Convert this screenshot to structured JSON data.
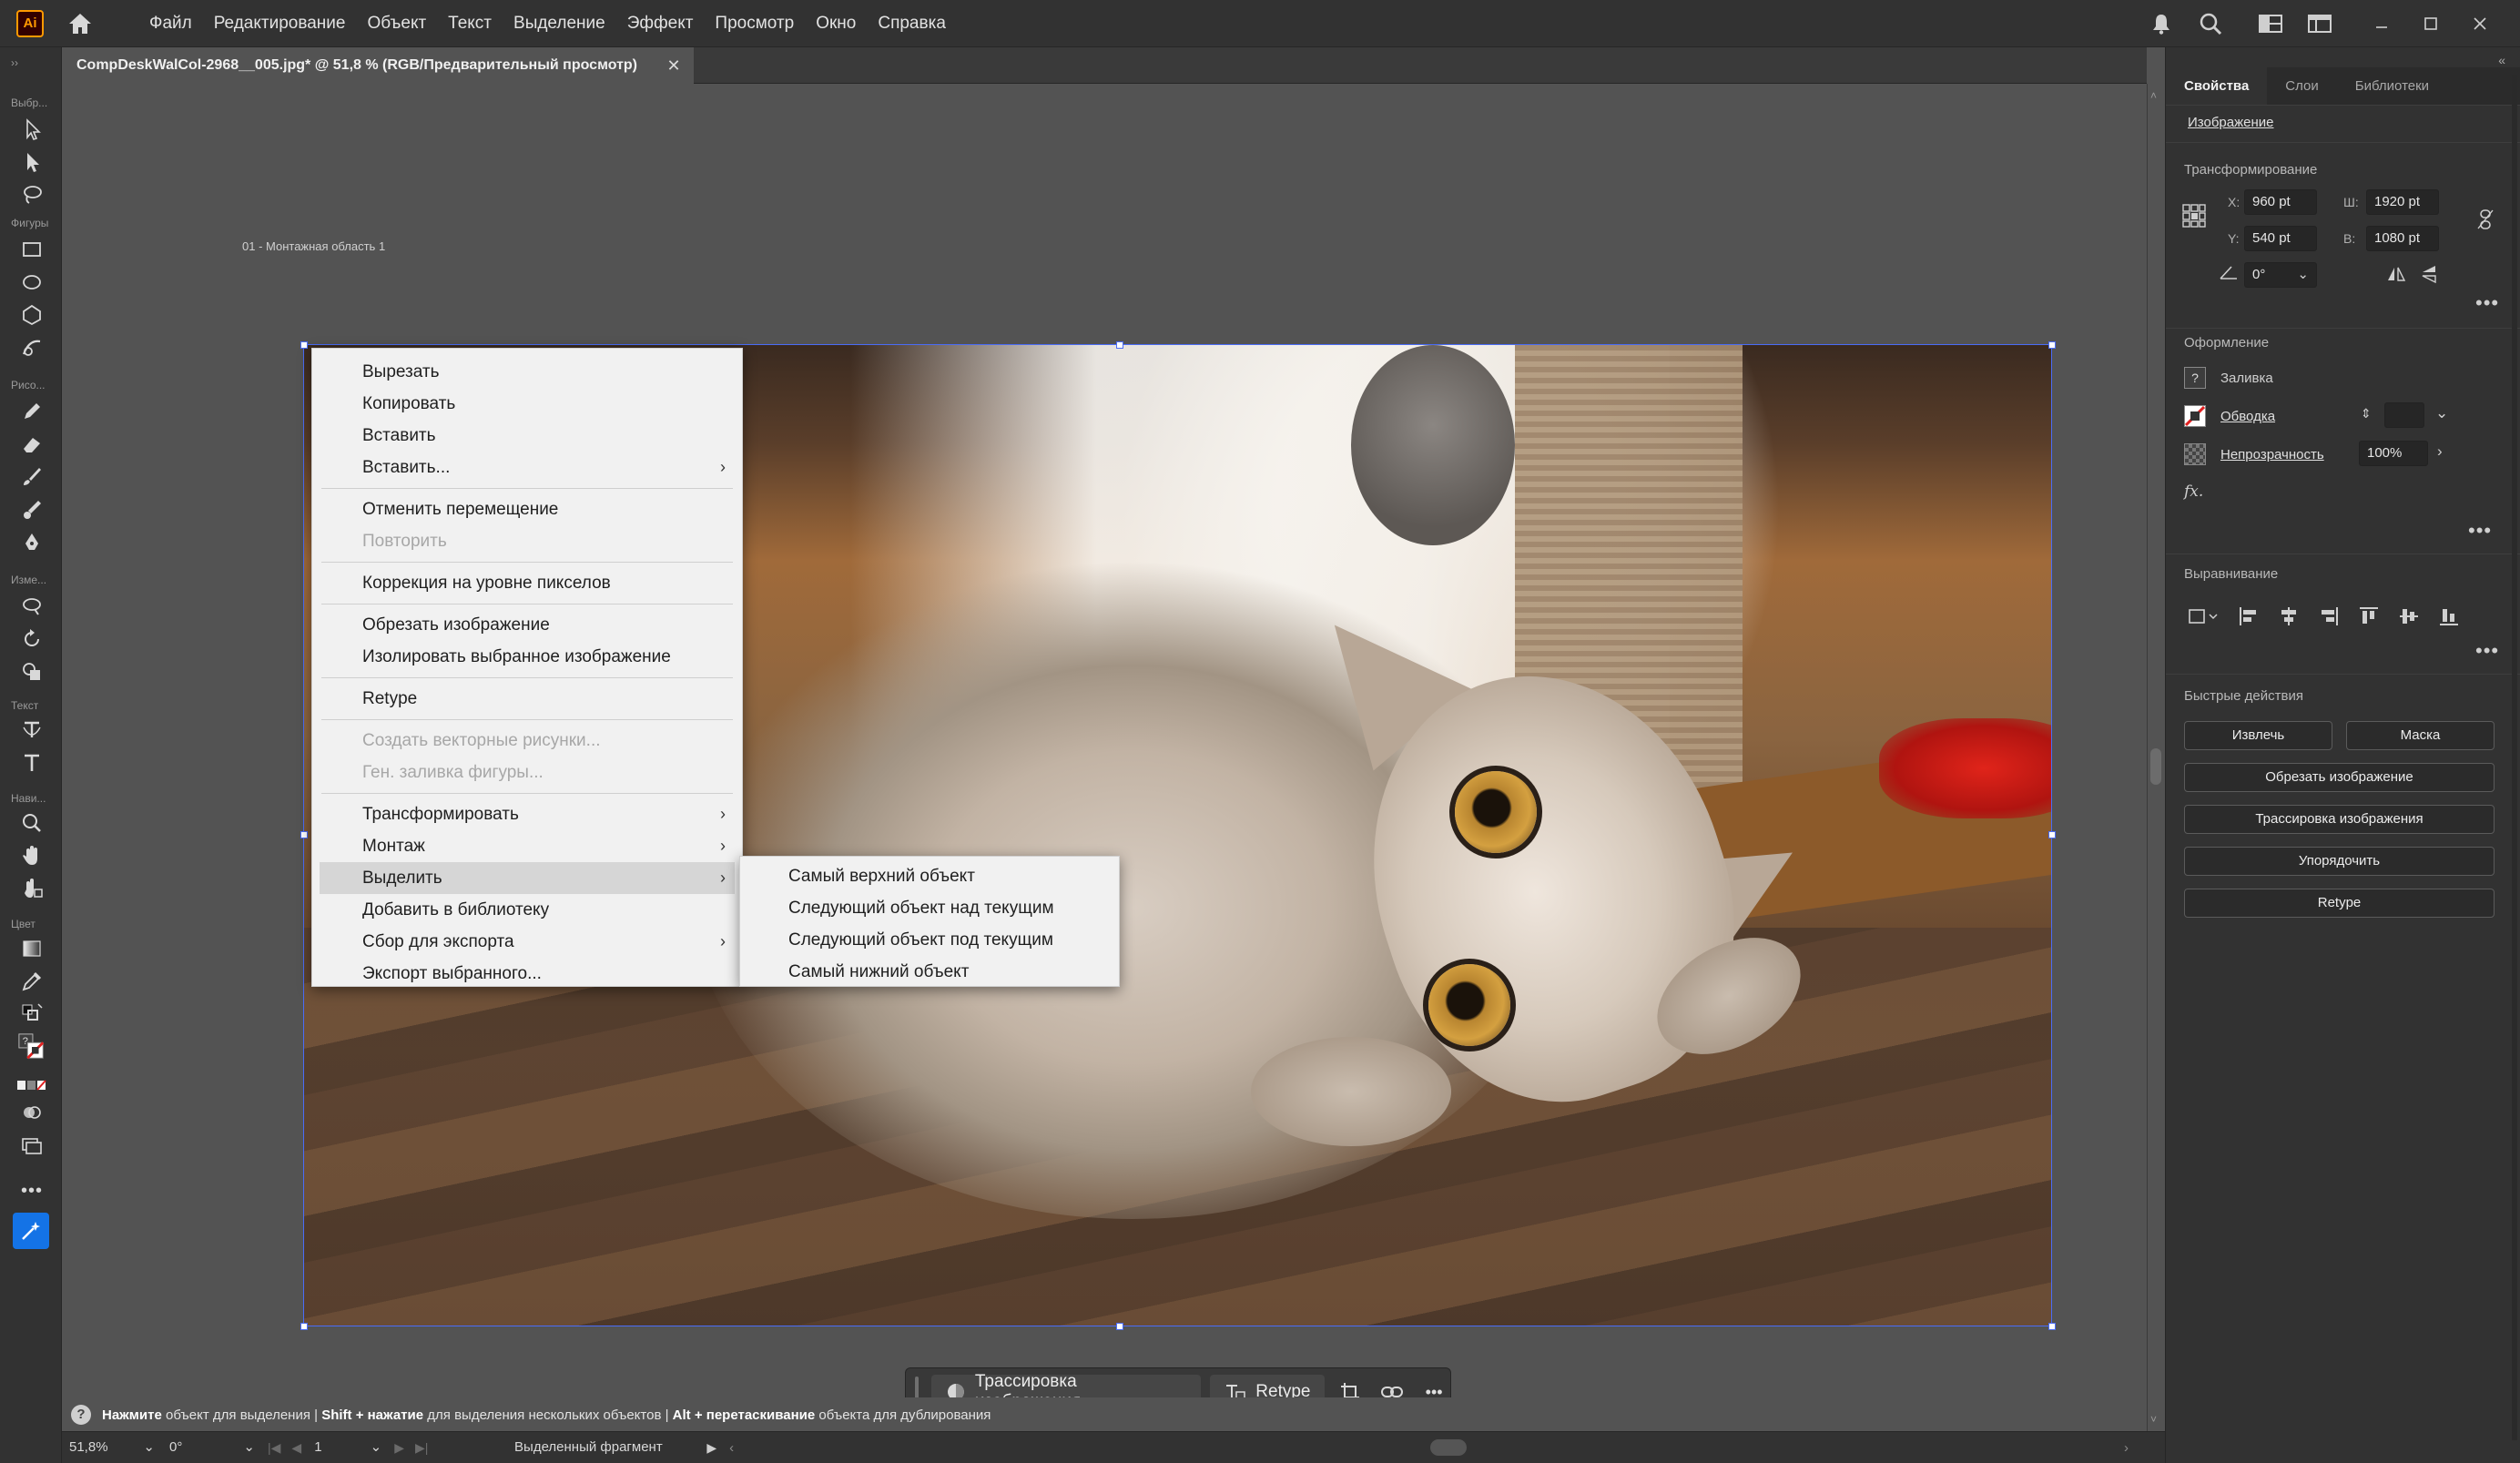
{
  "app": {
    "logo_text": "Ai",
    "menu": [
      "Файл",
      "Редактирование",
      "Объект",
      "Текст",
      "Выделение",
      "Эффект",
      "Просмотр",
      "Окно",
      "Справка"
    ]
  },
  "toolbar": {
    "groups": [
      "Выбр...",
      "Фигуры",
      "Рисо...",
      "Изме...",
      "Текст",
      "Нави...",
      "Цвет"
    ]
  },
  "document": {
    "tab_title": "CompDeskWalCol-2968__005.jpg* @ 51,8 % (RGB/Предварительный просмотр)",
    "close_glyph": "✕",
    "artboard_label": "01 - Монтажная область 1"
  },
  "context_menu": {
    "items": [
      {
        "label": "Вырезать",
        "enabled": true,
        "submenu": false
      },
      {
        "label": "Копировать",
        "enabled": true,
        "submenu": false
      },
      {
        "label": "Вставить",
        "enabled": true,
        "submenu": false
      },
      {
        "label": "Вставить...",
        "enabled": true,
        "submenu": true
      },
      {
        "label": "Отменить перемещение",
        "enabled": true,
        "submenu": false
      },
      {
        "label": "Повторить",
        "enabled": false,
        "submenu": false
      },
      {
        "label": "Коррекция на уровне пикселов",
        "enabled": true,
        "submenu": false
      },
      {
        "label": "Обрезать изображение",
        "enabled": true,
        "submenu": false
      },
      {
        "label": "Изолировать выбранное изображение",
        "enabled": true,
        "submenu": false
      },
      {
        "label": "Retype",
        "enabled": true,
        "submenu": false
      },
      {
        "label": "Создать векторные рисунки...",
        "enabled": false,
        "submenu": false
      },
      {
        "label": "Ген. заливка фигуры...",
        "enabled": false,
        "submenu": false
      },
      {
        "label": "Трансформировать",
        "enabled": true,
        "submenu": true
      },
      {
        "label": "Монтаж",
        "enabled": true,
        "submenu": true
      },
      {
        "label": "Выделить",
        "enabled": true,
        "submenu": true,
        "highlighted": true
      },
      {
        "label": "Добавить в библиотеку",
        "enabled": true,
        "submenu": false
      },
      {
        "label": "Сбор для экспорта",
        "enabled": true,
        "submenu": true
      },
      {
        "label": "Экспорт выбранного...",
        "enabled": true,
        "submenu": false
      }
    ],
    "arrow_glyph": "›"
  },
  "sub_menu": {
    "items": [
      "Самый верхний объект",
      "Следующий объект над текущим",
      "Следующий объект под текущим",
      "Самый нижний объект"
    ]
  },
  "taskbar": {
    "trace_label": "Трассировка изображения",
    "retype_label": "Retype"
  },
  "panel": {
    "tabs": [
      "Свойства",
      "Слои",
      "Библиотеки"
    ],
    "object_type": "Изображение",
    "transform": {
      "title": "Трансформирование",
      "x_label": "X:",
      "x": "960 pt",
      "y_label": "Y:",
      "y": "540 pt",
      "w_label": "Ш:",
      "w": "1920 pt",
      "h_label": "В:",
      "h": "1080 pt",
      "angle": "0°"
    },
    "appearance": {
      "title": "Оформление",
      "fill_label": "Заливка",
      "fill_swatch": "?",
      "stroke_label": "Обводка",
      "opacity_label": "Непрозрачность",
      "opacity": "100%",
      "fx": "fx."
    },
    "align": {
      "title": "Выравнивание"
    },
    "quick_actions": {
      "title": "Быстрые действия",
      "extract": "Извлечь",
      "mask": "Маска",
      "crop": "Обрезать изображение",
      "trace": "Трассировка изображения",
      "arrange": "Упорядочить",
      "retype": "Retype"
    },
    "more": "•••"
  },
  "hint": {
    "icon": "?",
    "part1_bold": "Нажмите",
    "part1": "объект для выделения",
    "part2_bold": "Shift + нажатие",
    "part2": "для выделения нескольких объектов",
    "part3_bold": "Alt + перетаскивание",
    "part3": "объекта для дублирования",
    "separator": "|"
  },
  "status": {
    "zoom": "51,8%",
    "rotation": "0°",
    "artboard_num": "1",
    "selection_info": "Выделенный фрагмент"
  }
}
